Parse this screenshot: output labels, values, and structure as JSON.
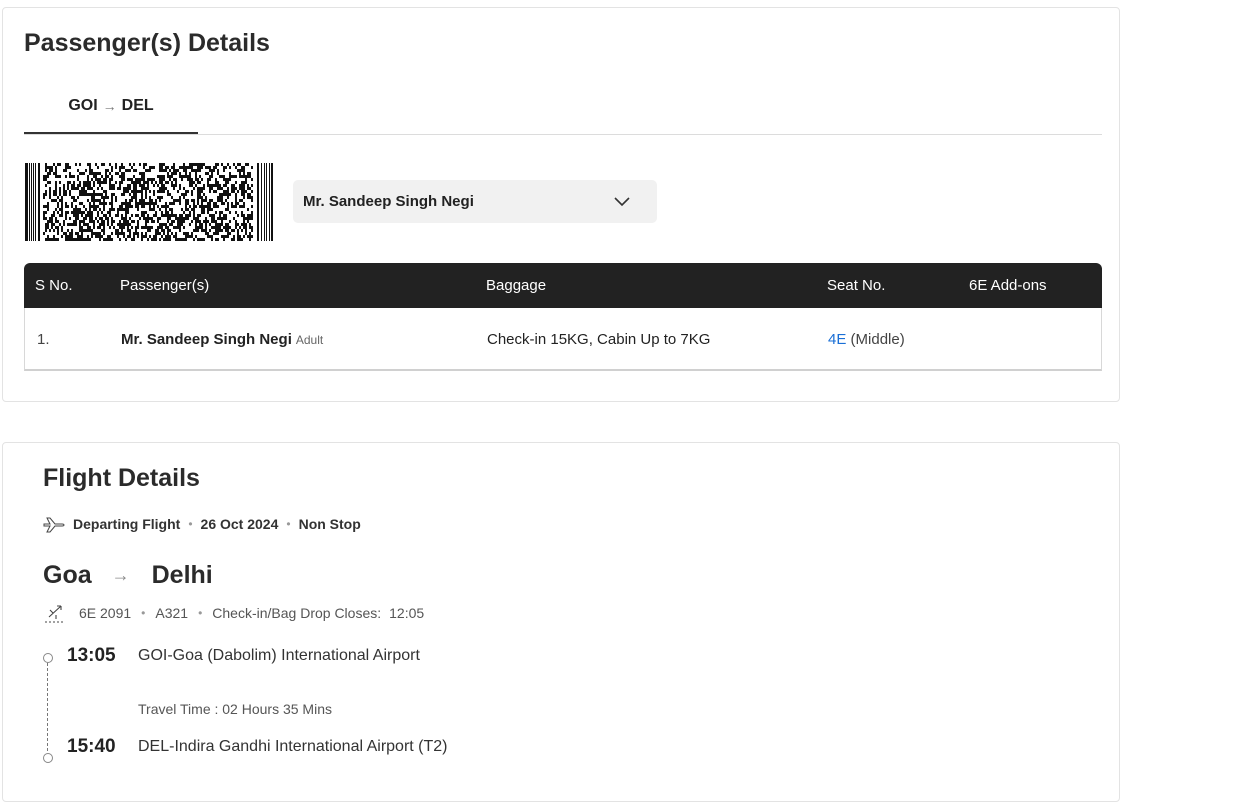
{
  "passenger_section": {
    "title": "Passenger(s) Details",
    "tab": {
      "from": "GOI",
      "arrow": "→",
      "to": "DEL"
    },
    "selected_passenger": "Mr. Sandeep Singh Negi",
    "table": {
      "headers": [
        "S No.",
        "Passenger(s)",
        "Baggage",
        "Seat No.",
        "6E Add-ons"
      ],
      "rows": [
        {
          "sno": "1.",
          "name": "Mr. Sandeep Singh Negi",
          "type": "Adult",
          "baggage": "Check-in 15KG, Cabin Up to 7KG",
          "seat": "4E",
          "seat_position": "(Middle)",
          "addons": ""
        }
      ]
    }
  },
  "flight_section": {
    "title": "Flight Details",
    "departing_label": "Departing Flight",
    "date": "26 Oct 2024",
    "stops": "Non Stop",
    "origin_city": "Goa",
    "destination_city": "Delhi",
    "flight_number": "6E 2091",
    "aircraft": "A321",
    "checkin_label": "Check-in/Bag Drop Closes:",
    "checkin_time": "12:05",
    "departure_time": "13:05",
    "departure_airport": "GOI-Goa (Dabolim) International Airport",
    "travel_time": "Travel Time : 02 Hours 35 Mins",
    "arrival_time": "15:40",
    "arrival_airport": "DEL-Indira Gandhi International Airport (T2)"
  },
  "colors": {
    "header_bg": "#222222",
    "link_blue": "#1a6fd6",
    "select_bg": "#f1f1f1"
  },
  "icons": [
    "barcode",
    "chevron-down-icon",
    "plane-depart-icon",
    "route-arrow-icon",
    "plane-takeoff-icon"
  ]
}
